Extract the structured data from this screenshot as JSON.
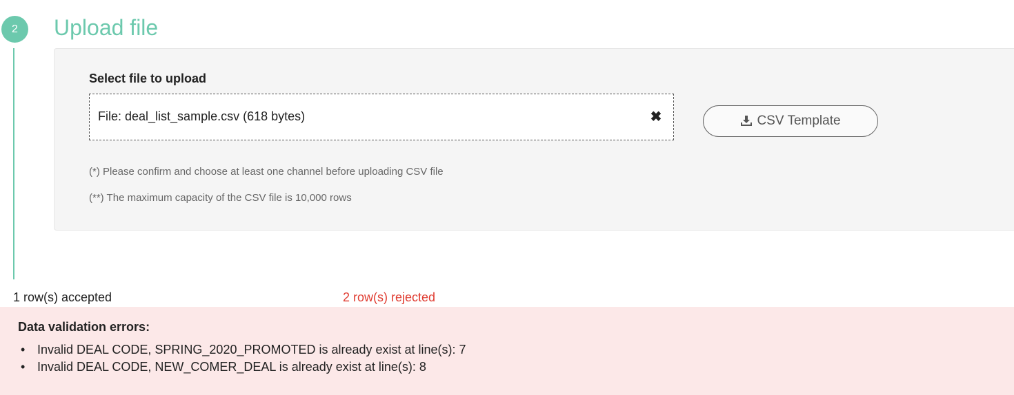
{
  "step": {
    "number": "2",
    "title": "Upload file"
  },
  "upload": {
    "label": "Select file to upload",
    "file_text": "File: deal_list_sample.csv (618 bytes)",
    "remove_icon": "close-icon",
    "template_button_label": "CSV Template",
    "template_button_icon": "download-icon",
    "notes": [
      "(*) Please confirm and choose at least one channel before uploading CSV file",
      "(**) The maximum capacity of the CSV file is 10,000 rows"
    ]
  },
  "result": {
    "accepted": "1 row(s) accepted",
    "rejected": "2 row(s) rejected",
    "rejected_color": "#e03c31"
  },
  "errors": {
    "title": "Data validation errors:",
    "items": [
      "Invalid DEAL CODE, SPRING_2020_PROMOTED is already exist at line(s): 7",
      "Invalid DEAL CODE, NEW_COMER_DEAL is already exist at line(s): 8"
    ]
  },
  "colors": {
    "accent": "#6cc9ad",
    "error_background": "#fce8e8"
  }
}
